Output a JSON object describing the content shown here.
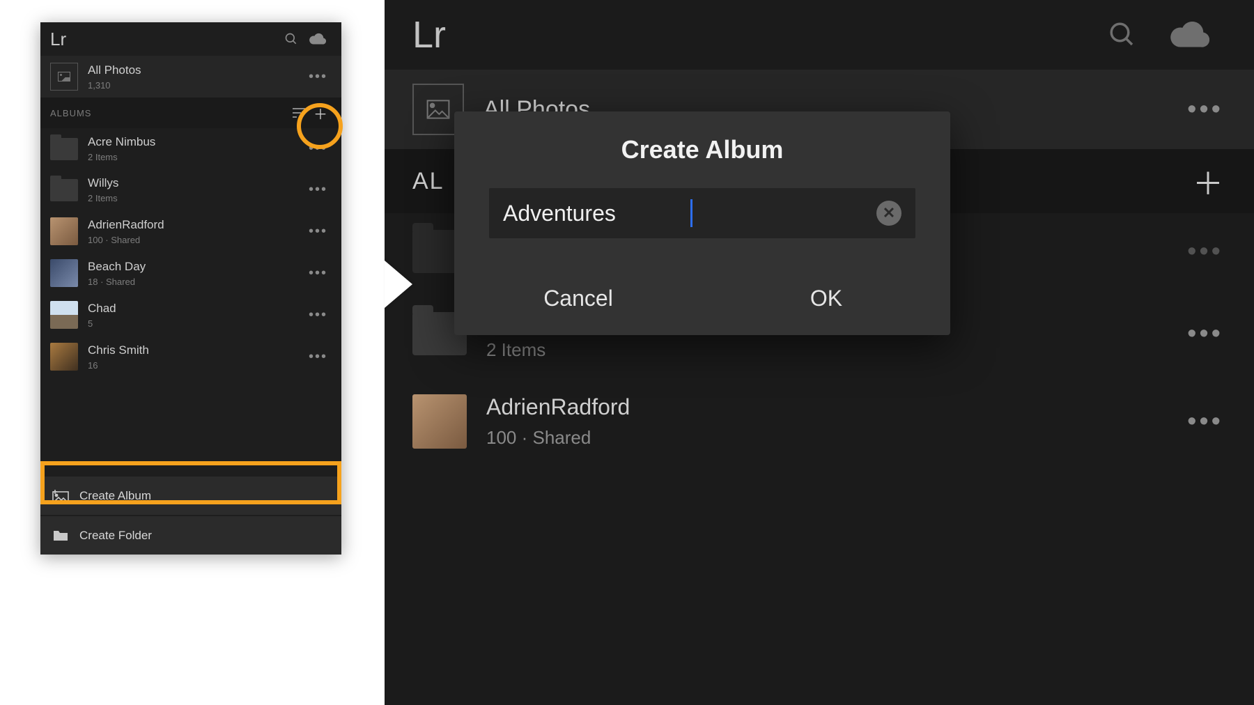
{
  "left": {
    "logo": "Lr",
    "all_photos": {
      "title": "All Photos",
      "count": "1,310"
    },
    "albums_header": "ALBUMS",
    "albums": [
      {
        "name": "Acre Nimbus",
        "meta": "2 Items",
        "kind": "folder"
      },
      {
        "name": "Willys",
        "meta": "2 Items",
        "kind": "folder"
      },
      {
        "name": "AdrienRadford",
        "meta": "100 · Shared",
        "kind": "album",
        "sw": "sw-a"
      },
      {
        "name": "Beach Day",
        "meta": "18 · Shared",
        "kind": "album",
        "sw": "sw-b"
      },
      {
        "name": "Chad",
        "meta": "5",
        "kind": "album",
        "sw": "sw-c"
      },
      {
        "name": "Chris Smith",
        "meta": "16",
        "kind": "album",
        "sw": "sw-d"
      }
    ],
    "actions": {
      "create_album": "Create Album",
      "create_folder": "Create Folder"
    }
  },
  "right": {
    "logo": "Lr",
    "all_photos_title": "All Photos",
    "albums_header_partial": "AL",
    "rows": [
      {
        "name": "Willys",
        "meta": "2 Items",
        "kind": "folder"
      },
      {
        "name": "AdrienRadford",
        "meta": "100 · Shared",
        "kind": "album",
        "sw": "sw-a"
      }
    ]
  },
  "dialog": {
    "title": "Create Album",
    "value": "Adventures",
    "cancel": "Cancel",
    "ok": "OK"
  }
}
